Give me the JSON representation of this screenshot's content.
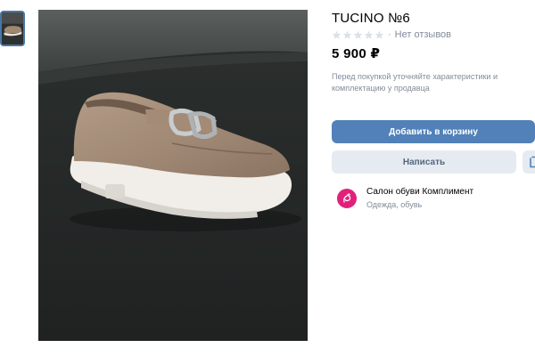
{
  "product": {
    "title": "TUCINO №6",
    "rating": {
      "stars_filled": 0,
      "stars_total": 5,
      "separator": "·",
      "reviews_text": "Нет отзывов"
    },
    "price": "5 900 ₽",
    "note": "Перед покупкой уточняйте характеристики и комплектацию у продавца"
  },
  "actions": {
    "add_to_cart_label": "Добавить в корзину",
    "message_label": "Написать"
  },
  "seller": {
    "name": "Салон обуви Комплимент",
    "category": "Одежда, обувь"
  },
  "gallery": {
    "thumbnails": 1,
    "selected_index": 0
  },
  "colors": {
    "accent": "#5181b8",
    "secondary_button_bg": "#e5ebf1",
    "secondary_button_text": "#55677d",
    "muted_text": "#818c99",
    "avatar_bg": "#e0217a",
    "star_empty": "#dce1e6"
  },
  "icons": {
    "star": "star-icon",
    "share": "share-icon",
    "avatar": "seller-logo-icon"
  }
}
